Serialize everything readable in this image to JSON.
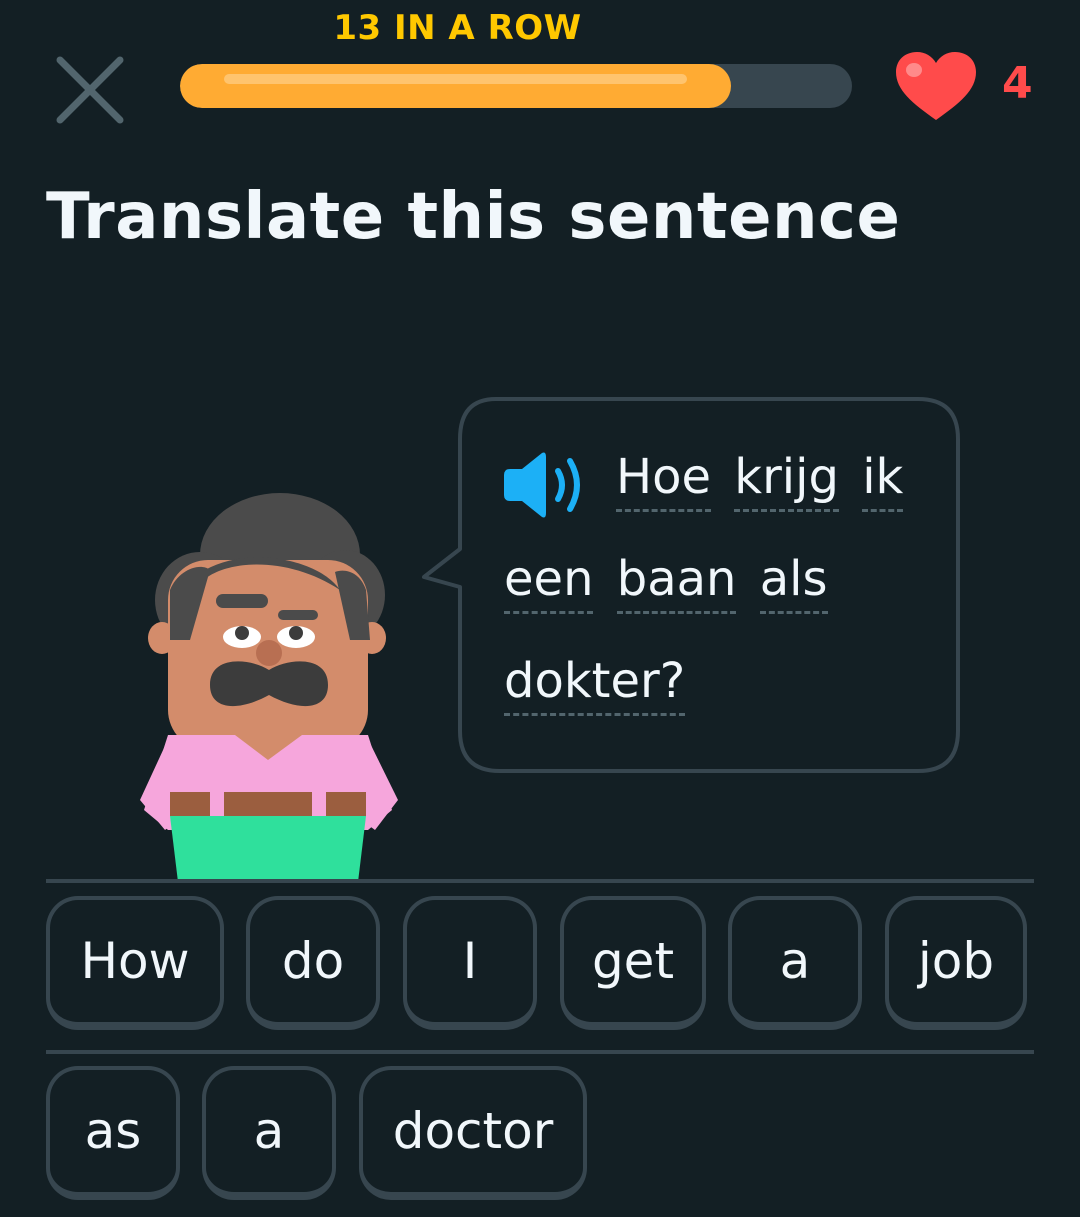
{
  "header": {
    "streak_text": "13 IN A ROW",
    "progress_fraction": 0.82,
    "hearts_count": "4",
    "close_icon": "close-icon",
    "heart_icon": "heart-icon"
  },
  "prompt": {
    "title": "Translate this sentence"
  },
  "speech": {
    "speaker_icon": "speaker-icon",
    "lines": [
      [
        "Hoe",
        "krijg",
        "ik"
      ],
      [
        "een",
        "baan",
        "als"
      ],
      [
        "dokter?"
      ]
    ]
  },
  "word_bank": {
    "row1": [
      "How",
      "do",
      "I",
      "get",
      "a",
      "job"
    ],
    "row2": [
      "as",
      "a",
      "doctor"
    ]
  },
  "colors": {
    "background": "#131f24",
    "streak": "#ffc800",
    "progress": "#ffab33",
    "heart": "#ff4b4b",
    "border": "#37464f",
    "speaker": "#1cb0f6"
  }
}
